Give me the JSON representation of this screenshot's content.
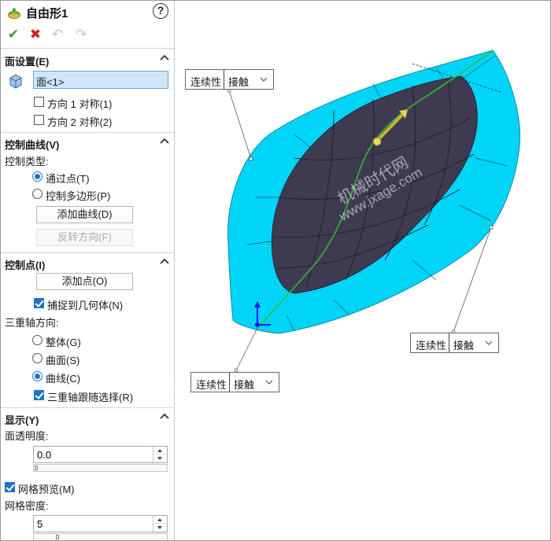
{
  "header": {
    "title": "自由形1",
    "help_label": "?",
    "ok_label": "✔",
    "cancel_label": "✖",
    "undo_label": "↶",
    "redo_label": "↷"
  },
  "face_settings": {
    "title": "面设置(E)",
    "selected_face": "面<1>",
    "sym_dir1": {
      "label": "方向 1 对称(1)",
      "checked": false
    },
    "sym_dir2": {
      "label": "方向 2 对称(2)",
      "checked": false
    }
  },
  "control_curves": {
    "title": "控制曲线(V)",
    "type_label": "控制类型:",
    "through_points": {
      "label": "通过点(T)",
      "selected": true
    },
    "control_polygon": {
      "label": "控制多边形(P)",
      "selected": false
    },
    "add_curve_label": "添加曲线(D)",
    "flip_direction_label": "反转方向(F)"
  },
  "control_points": {
    "title": "控制点(I)",
    "add_point_label": "添加点(O)",
    "snap_to_geometry": {
      "label": "捕捉到几何体(N)",
      "checked": true
    },
    "triad_direction_label": "三重轴方向:",
    "triad_global": {
      "label": "整体(G)",
      "selected": false
    },
    "triad_surface": {
      "label": "曲面(S)",
      "selected": false
    },
    "triad_curve": {
      "label": "曲线(C)",
      "selected": true
    },
    "triad_follow_selection": {
      "label": "三重轴跟随选择(R)",
      "checked": true
    }
  },
  "display": {
    "title": "显示(Y)",
    "transparency_label": "面透明度:",
    "transparency_value": "0.0",
    "mesh_preview": {
      "label": "网格预览(M)",
      "checked": true
    },
    "mesh_density_label": "网格密度:",
    "mesh_density_value": "5"
  },
  "viewport": {
    "continuity_boxes": [
      {
        "key": "连续性",
        "value": "接触"
      },
      {
        "key": "连续性",
        "value": "接触"
      },
      {
        "key": "连续性",
        "value": "接触"
      }
    ],
    "watermark_line1": "机械时代网",
    "watermark_line2": "www.jxage.com",
    "colors": {
      "surface_edge": "#00d4f7",
      "surface_body": "#3e3a52",
      "control_curve": "#2ec52e",
      "triad_handle": "#e8d860"
    }
  }
}
